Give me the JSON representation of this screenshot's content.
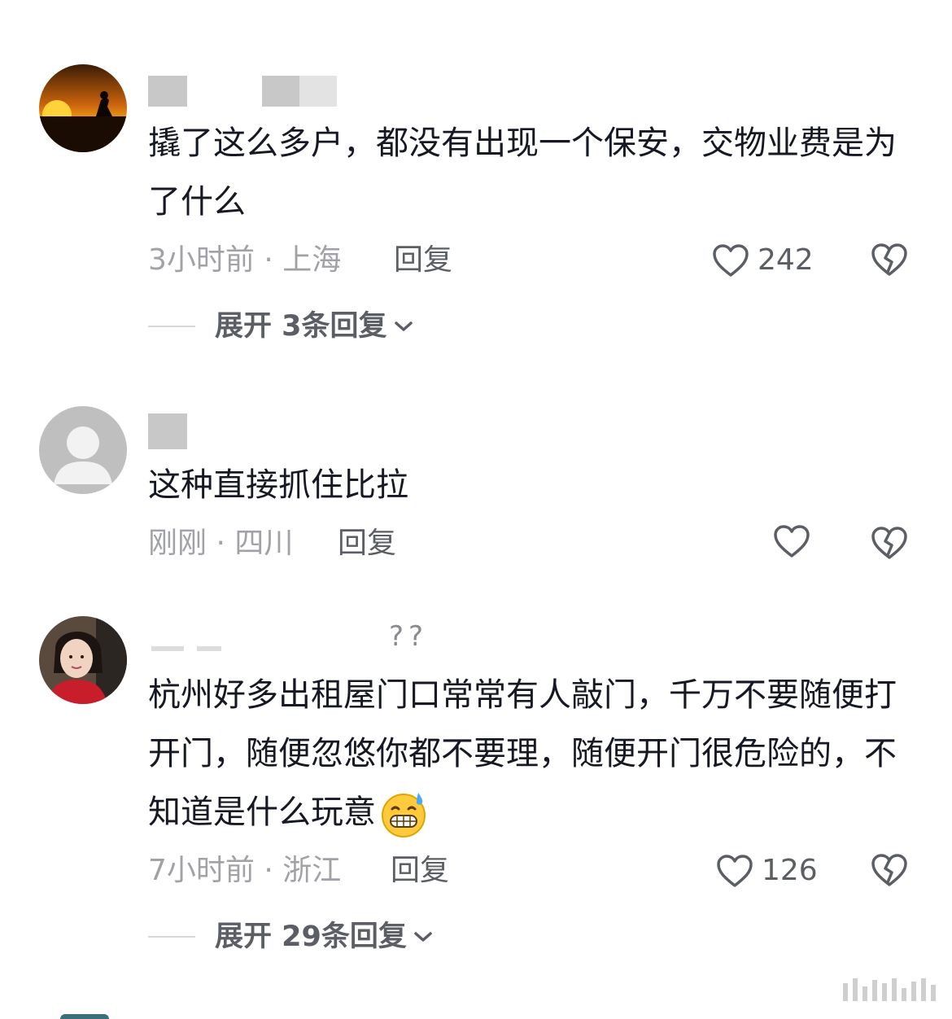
{
  "comments": [
    {
      "content": "撬了这么多户，都没有出现一个保安，交物业费是为了什么",
      "meta": "3小时前 · 上海",
      "reply_label": "回复",
      "likes": "242",
      "expand_label": "展开 3条回复"
    },
    {
      "content": "这种直接抓住比拉",
      "meta": "刚刚 · 四川",
      "reply_label": "回复",
      "likes": ""
    },
    {
      "name_suffix": "??",
      "content": "杭州好多出租屋门口常常有人敲门，千万不要随便打开门，随便忽悠你都不要理，随便开门很危险的，不知道是什么玩意",
      "meta": "7小时前 · 浙江",
      "reply_label": "回复",
      "likes": "126",
      "expand_label": "展开 29条回复"
    }
  ],
  "icons": {
    "like": "heart-outline-icon",
    "dislike": "broken-heart-icon",
    "expand": "chevron-down-icon",
    "emoji": "grinning-sweat-emoji"
  },
  "colors": {
    "text": "#161823",
    "meta": "#a1a2a8",
    "secondary": "#5c5e66"
  }
}
